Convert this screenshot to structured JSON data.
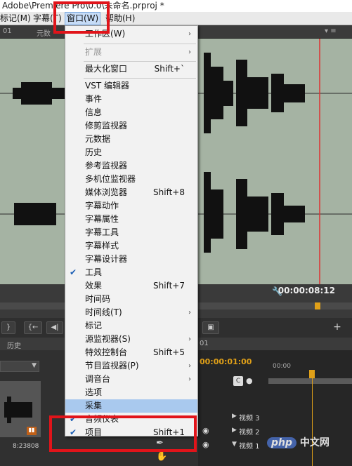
{
  "title_bar": {
    "text": "Adobe\\Premiere Pro\\0.0\\未命名.prproj *"
  },
  "menu_bar": {
    "items": [
      {
        "label": "标记(M)"
      },
      {
        "label": "字幕(T)"
      },
      {
        "label": "窗口(W)",
        "active": true
      },
      {
        "label": "帮助(H)"
      }
    ]
  },
  "panel": {
    "tab_left": "01",
    "tab_metadata": "元数",
    "history_tab": "历史",
    "timecode": "00:00:08:12",
    "clip_time": "8:23808",
    "sequence_time": "00:00:01:00",
    "ruler_time": "00:00"
  },
  "tracks": [
    {
      "label": "视频 3"
    },
    {
      "label": "视频 2"
    },
    {
      "label": "视频 1"
    }
  ],
  "window_menu": {
    "items": [
      {
        "label": "工作区(W)",
        "submenu": true
      },
      {
        "label": "扩展",
        "submenu": true,
        "disabled": true
      },
      {
        "label": "最大化窗口",
        "shortcut": "Shift+`"
      },
      {
        "label": "VST 编辑器"
      },
      {
        "label": "事件"
      },
      {
        "label": "信息"
      },
      {
        "label": "修剪监视器"
      },
      {
        "label": "元数据"
      },
      {
        "label": "历史"
      },
      {
        "label": "参考监视器"
      },
      {
        "label": "多机位监视器"
      },
      {
        "label": "媒体浏览器",
        "shortcut": "Shift+8"
      },
      {
        "label": "字幕动作"
      },
      {
        "label": "字幕属性"
      },
      {
        "label": "字幕工具"
      },
      {
        "label": "字幕样式"
      },
      {
        "label": "字幕设计器"
      },
      {
        "label": "工具",
        "checked": true
      },
      {
        "label": "效果",
        "shortcut": "Shift+7"
      },
      {
        "label": "时间码"
      },
      {
        "label": "时间线(T)",
        "submenu": true
      },
      {
        "label": "标记"
      },
      {
        "label": "源监视器(S)",
        "submenu": true
      },
      {
        "label": "特效控制台",
        "shortcut": "Shift+5"
      },
      {
        "label": "节目监视器(P)",
        "submenu": true
      },
      {
        "label": "调音台",
        "submenu": true
      },
      {
        "label": "选项"
      },
      {
        "label": "采集",
        "highlighted": true
      },
      {
        "label": "音频仪表",
        "checked": true
      },
      {
        "label": "项目",
        "shortcut": "Shift+1",
        "checked": true
      }
    ]
  },
  "watermark": {
    "brand": "php",
    "site": "中文网"
  },
  "colors": {
    "annotation_red": "#e1141a",
    "menu_highlight": "#a9c9ee",
    "waveform_bg": "#a5b3a3",
    "timeline_marker": "#e0a018"
  }
}
